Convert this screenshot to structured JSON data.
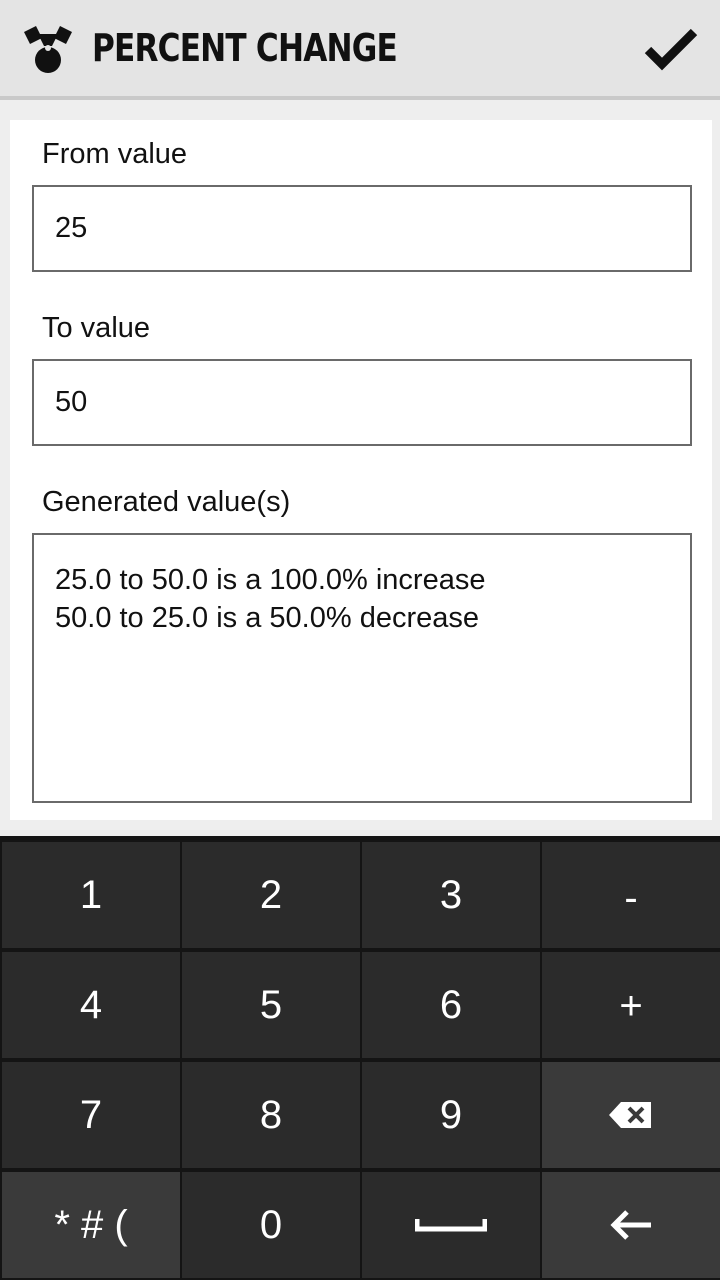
{
  "appbar": {
    "title": "Percent Change",
    "icon": "hazard-badge-icon",
    "confirm_icon": "checkmark-icon"
  },
  "form": {
    "from": {
      "label": "From value",
      "value": "25"
    },
    "to": {
      "label": "To value",
      "value": "50"
    },
    "result": {
      "label": "Generated value(s)",
      "value": "25.0 to 50.0 is a 100.0% increase\n50.0 to 25.0 is a 50.0% decrease"
    }
  },
  "keyboard": {
    "rows": [
      [
        "1",
        "2",
        "3",
        "-"
      ],
      [
        "4",
        "5",
        "6",
        "+"
      ],
      [
        "7",
        "8",
        "9",
        "backspace"
      ],
      [
        "* # (",
        "0",
        "space",
        "enter"
      ]
    ],
    "k1": "1",
    "k2": "2",
    "k3": "3",
    "kminus": "-",
    "k4": "4",
    "k5": "5",
    "k6": "6",
    "kplus": "+",
    "k7": "7",
    "k8": "8",
    "k9": "9",
    "ksym": "* # (",
    "k0": "0"
  }
}
